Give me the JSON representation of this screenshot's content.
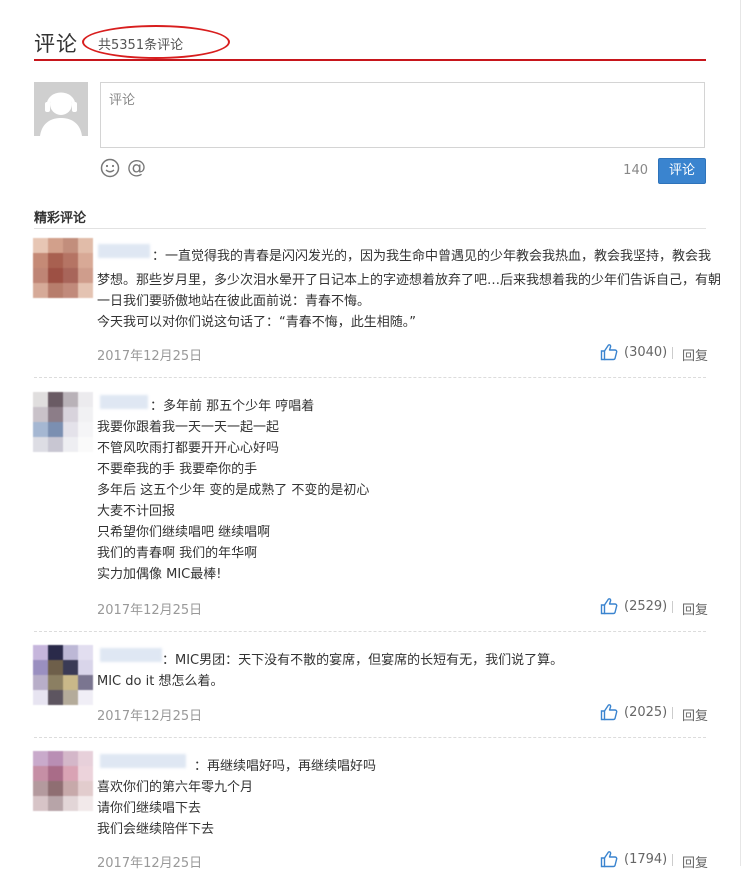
{
  "header": {
    "title": "评论",
    "count_text": "共5351条评论"
  },
  "composer": {
    "placeholder": "评论",
    "char_count": "140",
    "submit_label": "评论",
    "emoji_icon": "smiley-icon",
    "at_symbol": "@"
  },
  "section": {
    "title": "精彩评论"
  },
  "comments": [
    {
      "lines": [
        "：一直觉得我的青春是闪闪发光的，因为我生命中曾遇见的少年教会我热血，教会我坚持，教会我",
        "梦想。那些岁月里，多少次泪水晕开了日记本上的字迹想着放弃了吧…后来我想着我的少年们告诉自己，有朝",
        "一日我们要骄傲地站在彼此面前说：青春不悔。",
        "今天我可以对你们说这句话了：“青春不悔，此生相随。”"
      ],
      "date": "2017年12月25日",
      "likes": "(3040)",
      "reply_label": "回复",
      "avatar_colors": [
        "#e7c6b4",
        "#d2a08b",
        "#c28e7c",
        "#e1bca9",
        "#c58a76",
        "#a86050",
        "#b57464",
        "#d8a996",
        "#bf8575",
        "#9d5044",
        "#a8655a",
        "#cf9d8c",
        "#d6aa98",
        "#b77d6c",
        "#c18a7b",
        "#e4c3b2"
      ]
    },
    {
      "lines": [
        "：多年前 那五个少年 哼唱着",
        "我要你跟着我一天一天一起一起",
        "不管风吹雨打都要开开心心好吗",
        "不要牵我的手 我要牵你的手",
        "多年后 这五个少年 变的是成熟了 不变的是初心",
        "大麦不计回报",
        "只希望你们继续唱吧 继续唱啊",
        "我们的青春啊 我们的年华啊",
        "实力加偶像 MIC最棒!"
      ],
      "date": "2017年12月25日",
      "likes": "(2529)",
      "reply_label": "回复",
      "avatar_colors": [
        "#e0dede",
        "#6a5b64",
        "#b9b2b8",
        "#ecebee",
        "#c9c2c9",
        "#8c7d88",
        "#d8d3dc",
        "#f1f1f3",
        "#a5b7d2",
        "#7b8fb1",
        "#e4e2ea",
        "#f5f5f7",
        "#dddde4",
        "#c8c6d2",
        "#eeeef2",
        "#fafafa"
      ]
    },
    {
      "lines": [
        "：MIC男团：天下没有不散的宴席，但宴席的长短有无，我们说了算。",
        "MIC do it 想怎么着。"
      ],
      "date": "2017年12月25日",
      "likes": "(2025)",
      "reply_label": "回复",
      "avatar_colors": [
        "#c6b6dc",
        "#2a2a4a",
        "#bdb8d6",
        "#e2def0",
        "#9a8fc0",
        "#6e5f4a",
        "#3a3a55",
        "#d9d5ea",
        "#b8aec8",
        "#8b7f62",
        "#c9b889",
        "#7a7590",
        "#e7e4f1",
        "#5d5560",
        "#b4ab9a",
        "#f0eef6"
      ]
    },
    {
      "lines": [
        "：再继续唱好吗，再继续唱好吗",
        "喜欢你们的第六年零九个月",
        "请你们继续唱下去",
        "我们会继续陪伴下去"
      ],
      "date": "2017年12月25日",
      "likes": "(1794)",
      "reply_label": "回复",
      "avatar_colors": [
        "#c9aacb",
        "#b98eb4",
        "#d4b7c9",
        "#e7d0da",
        "#c68fa5",
        "#a96c88",
        "#d9a3b4",
        "#ecd3db",
        "#b49a9e",
        "#8f6e72",
        "#c7a9aa",
        "#e2cccd",
        "#d7c4c7",
        "#b7a4a8",
        "#e2d5d7",
        "#f2e9ea"
      ]
    }
  ]
}
